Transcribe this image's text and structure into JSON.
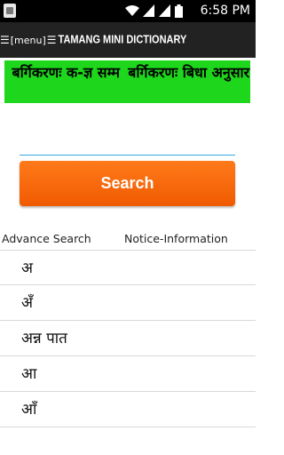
{
  "status_bar": {
    "time": "6:58 PM",
    "icons": [
      "notification-icon",
      "wifi-icon",
      "signal-icon",
      "signal-icon",
      "battery-icon"
    ]
  },
  "action_bar": {
    "menu_label": "[menu]",
    "title": "TAMANG MINI DICTIONARY"
  },
  "categories": [
    {
      "label": "बर्गिकरणः क-ज्ञ सम्म"
    },
    {
      "label": "बर्गिकरणः बिधा अनुसार"
    }
  ],
  "search": {
    "value": "",
    "button_label": "Search"
  },
  "links": {
    "advance": "Advance Search",
    "notice": "Notice-Information"
  },
  "words": [
    "अ",
    "अँ",
    "अन्न पात",
    "आ",
    "आँ"
  ],
  "colors": {
    "accent_green": "#1ed61c",
    "search_orange": "#f66a0a",
    "action_bar": "#222222"
  }
}
